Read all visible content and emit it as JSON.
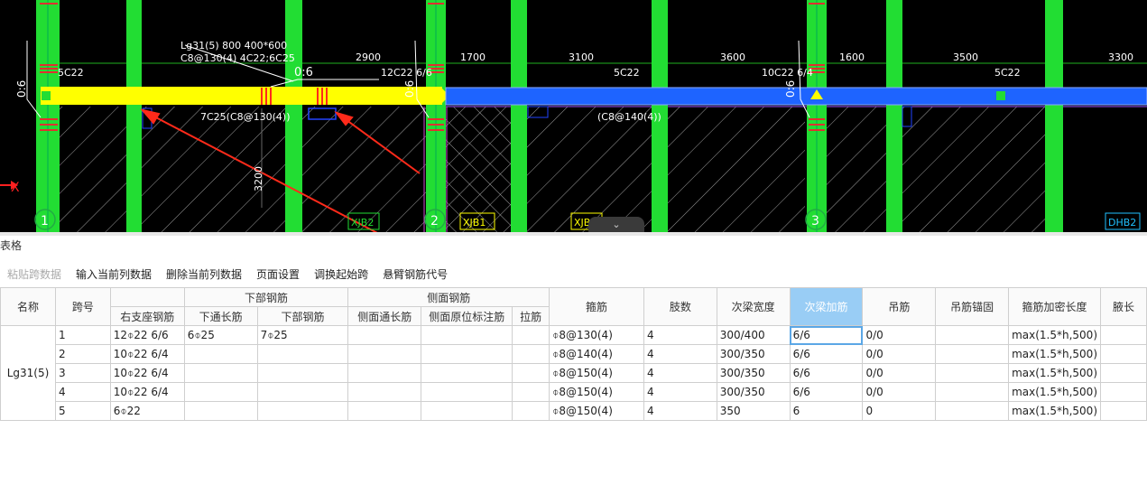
{
  "cad": {
    "beam_label_line1": "Lg31(5) 800 400*600",
    "beam_label_line2": "C8@130(4) 4C22;6C25",
    "left_note": "5C22",
    "ratio_a": "0:6",
    "ratio_b": "0:6",
    "ratio_c": "0:6",
    "ratio_d": "0:6",
    "mid_note_1": "2900",
    "mid_note_2": "12C22 6/6",
    "dim_1": "1700",
    "dim_2": "3100",
    "bar_note_1": "5C22",
    "dim_3": "3600",
    "bar_note_2": "10C22 6/4",
    "dim_4": "1600",
    "dim_5": "3500",
    "bar_note_3": "5C22",
    "dim_6": "3300",
    "stirrup_note_1": "7C25(C8@130(4))",
    "stirrup_note_2": "(C8@140(4))",
    "vertical_dim": "3200",
    "x_axis": "X",
    "axis_1": "1",
    "axis_2": "2",
    "axis_3": "3",
    "tag_1": "XJB2",
    "tag_2": "XJB1",
    "tag_3": "XJB",
    "tag_4": "DHB2",
    "collapse_glyph": "⌄"
  },
  "panel": {
    "title": "表格",
    "toolbar": [
      "粘贴跨数据",
      "输入当前列数据",
      "删除当前列数据",
      "页面设置",
      "调换起始跨",
      "悬臂钢筋代号"
    ]
  },
  "table": {
    "h_name": "名称",
    "h_span": "跨号",
    "h_group_bottom": "下部钢筋",
    "h_group_side": "侧面钢筋",
    "h_right_support": "右支座钢筋",
    "h_bottom_through": "下通长筋",
    "h_bottom_bar": "下部钢筋",
    "h_side_through": "侧面通长筋",
    "h_side_orig": "侧面原位标注筋",
    "h_tie": "拉筋",
    "h_stirrup": "箍筋",
    "h_legs": "肢数",
    "h_sec_width": "次梁宽度",
    "h_sec_add": "次梁加筋",
    "h_hanger": "吊筋",
    "h_hanger_anchor": "吊筋锚固",
    "h_dense_len": "箍筋加密长度",
    "h_haunch": "腋长",
    "beam_name": "Lg31(5)",
    "rows": [
      {
        "span": "1",
        "right": "12⌽22 6/6",
        "bthru": "6⌽25",
        "bbar": "7⌽25",
        "sthru": "",
        "sorig": "",
        "tie": "",
        "stirrup": "⌽8@130(4)",
        "legs": "4",
        "width": "300/400",
        "add": "6/6",
        "hanger": "0/0",
        "anchor": "",
        "dense": "max(1.5*h,500)",
        "haunch": ""
      },
      {
        "span": "2",
        "right": "10⌽22 6/4",
        "bthru": "",
        "bbar": "",
        "sthru": "",
        "sorig": "",
        "tie": "",
        "stirrup": "⌽8@140(4)",
        "legs": "4",
        "width": "300/350",
        "add": "6/6",
        "hanger": "0/0",
        "anchor": "",
        "dense": "max(1.5*h,500)",
        "haunch": ""
      },
      {
        "span": "3",
        "right": "10⌽22 6/4",
        "bthru": "",
        "bbar": "",
        "sthru": "",
        "sorig": "",
        "tie": "",
        "stirrup": "⌽8@150(4)",
        "legs": "4",
        "width": "300/350",
        "add": "6/6",
        "hanger": "0/0",
        "anchor": "",
        "dense": "max(1.5*h,500)",
        "haunch": ""
      },
      {
        "span": "4",
        "right": "10⌽22 6/4",
        "bthru": "",
        "bbar": "",
        "sthru": "",
        "sorig": "",
        "tie": "",
        "stirrup": "⌽8@150(4)",
        "legs": "4",
        "width": "300/350",
        "add": "6/6",
        "hanger": "0/0",
        "anchor": "",
        "dense": "max(1.5*h,500)",
        "haunch": ""
      },
      {
        "span": "5",
        "right": "6⌽22",
        "bthru": "",
        "bbar": "",
        "sthru": "",
        "sorig": "",
        "tie": "",
        "stirrup": "⌽8@150(4)",
        "legs": "4",
        "width": "350",
        "add": "6",
        "hanger": "0",
        "anchor": "",
        "dense": "max(1.5*h,500)",
        "haunch": ""
      }
    ]
  },
  "colors": {
    "column_green": "#22dd33",
    "beam_yellow": "#ffff00",
    "beam_blue": "#1e64ff",
    "header_highlight": "#99cdf5",
    "annotation_red": "#ff2a1a"
  }
}
